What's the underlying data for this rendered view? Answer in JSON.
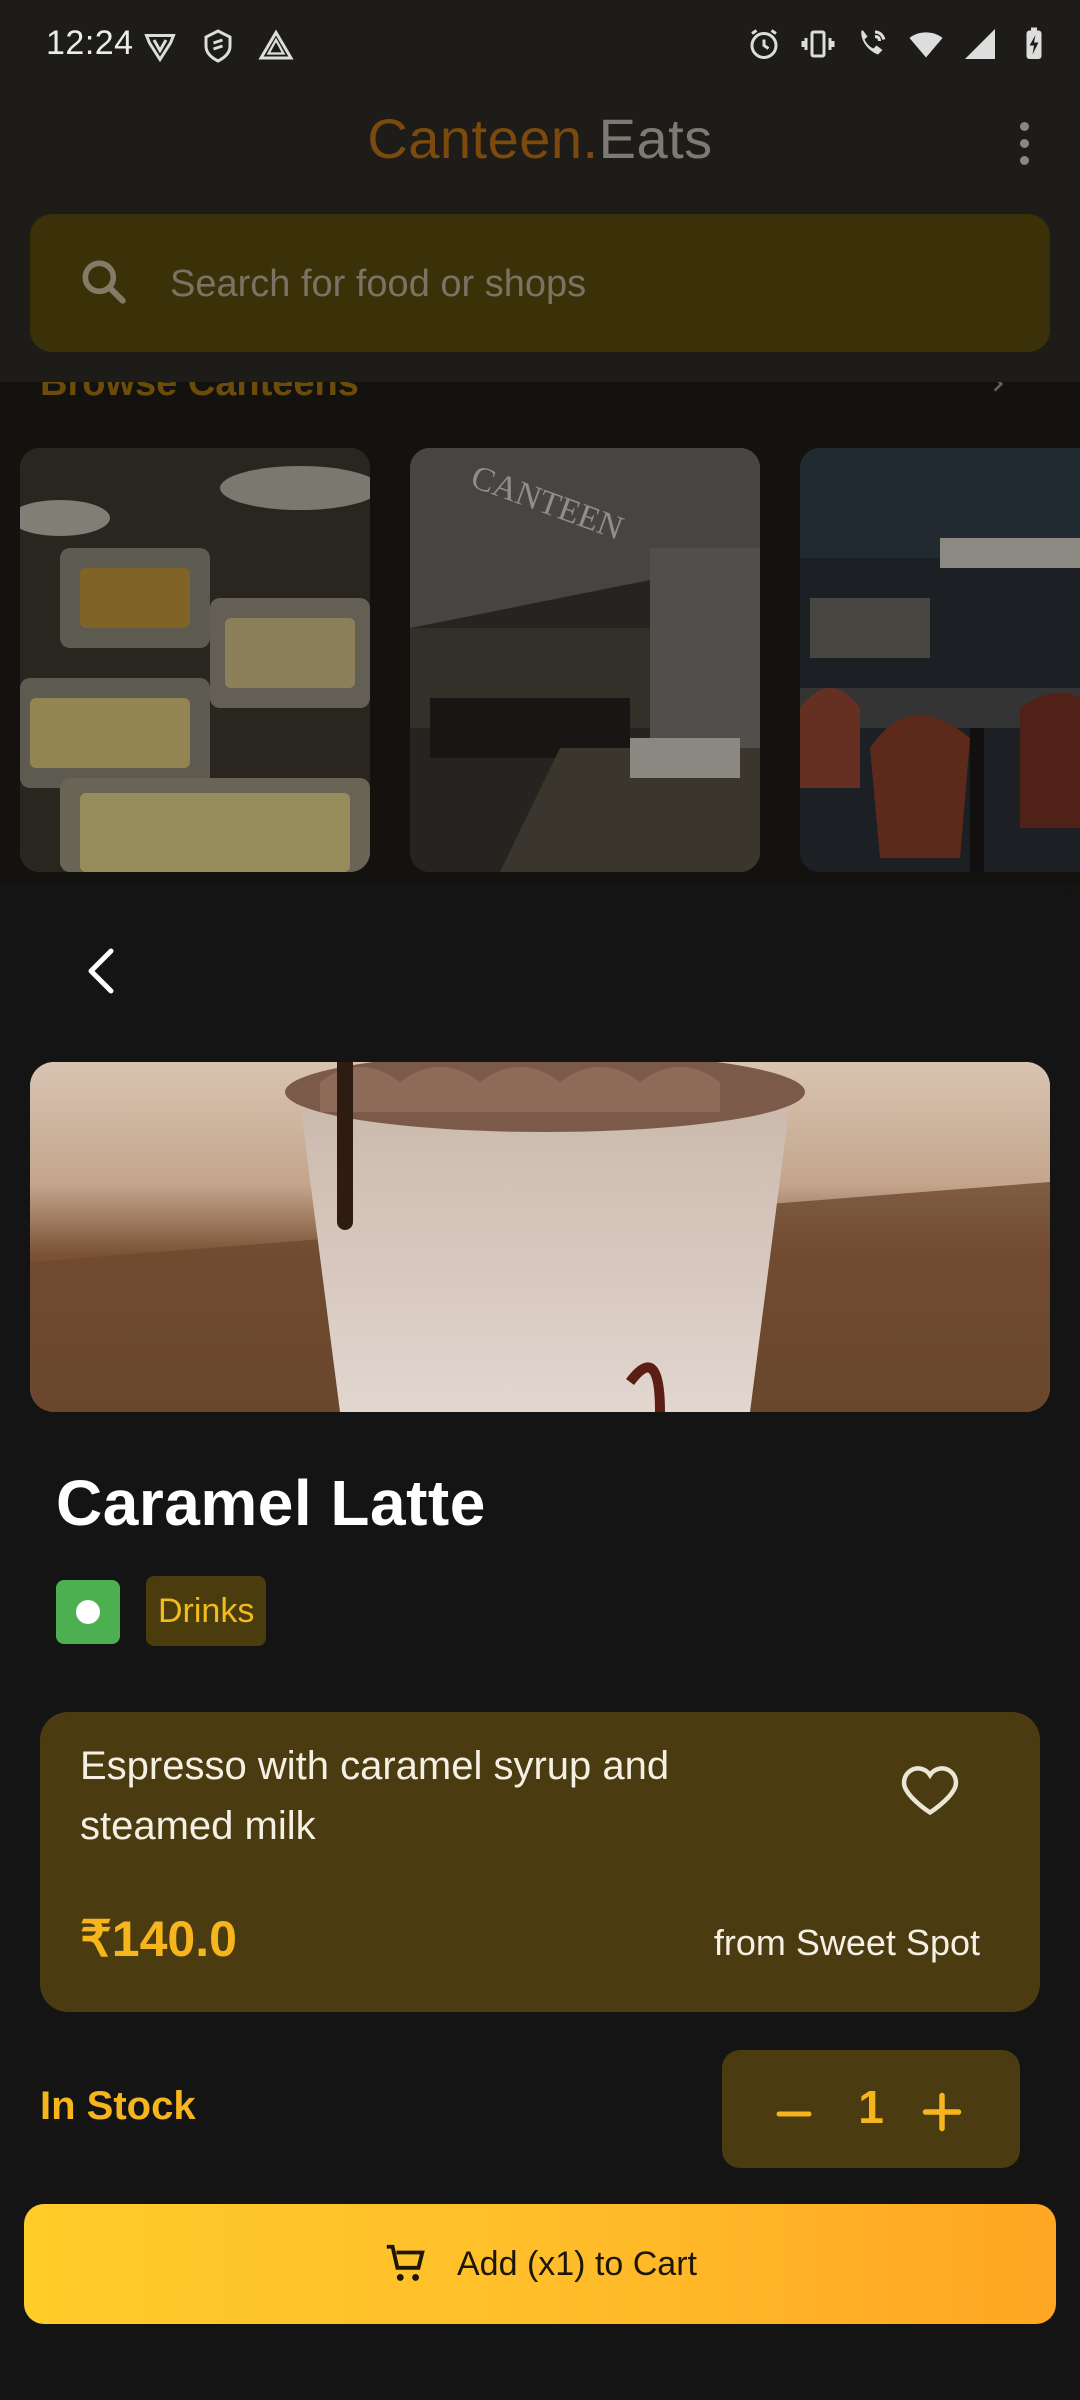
{
  "status_bar": {
    "time": "12:24",
    "left_icons": [
      "shield-v-icon",
      "dollar-shield-icon",
      "triangle-alert-icon"
    ],
    "right_icons": [
      "alarm-icon",
      "vibrate-icon",
      "wifi-call-icon",
      "wifi-icon",
      "signal-icon",
      "battery-charging-icon"
    ]
  },
  "header": {
    "brand_part1": "Canteen.",
    "brand_part2": "Eats",
    "menu_icon": "more-vertical-icon"
  },
  "search": {
    "placeholder": "Search for food or shops",
    "icon": "search-icon"
  },
  "browse": {
    "label": "Browse Canteens",
    "cards": [
      {
        "name": "canteen-card-buffet"
      },
      {
        "name": "canteen-card-hall"
      },
      {
        "name": "canteen-card-dining"
      }
    ]
  },
  "item": {
    "name": "Caramel Latte",
    "category": "Drinks",
    "veg": true,
    "description": "Espresso with caramel syrup and steamed milk",
    "price": "₹140.0",
    "shop": "from Sweet Spot",
    "stock": "In Stock",
    "quantity": "1"
  },
  "actions": {
    "add_to_cart": "Add (x1) to Cart"
  },
  "colors": {
    "accent": "#F6B51C",
    "brand_orange": "#7C4A0C",
    "card_bg": "#4A3C10",
    "button_gradient_start": "#FFCC29",
    "button_gradient_end": "#FFA622",
    "veg_green": "#4CAF50"
  }
}
